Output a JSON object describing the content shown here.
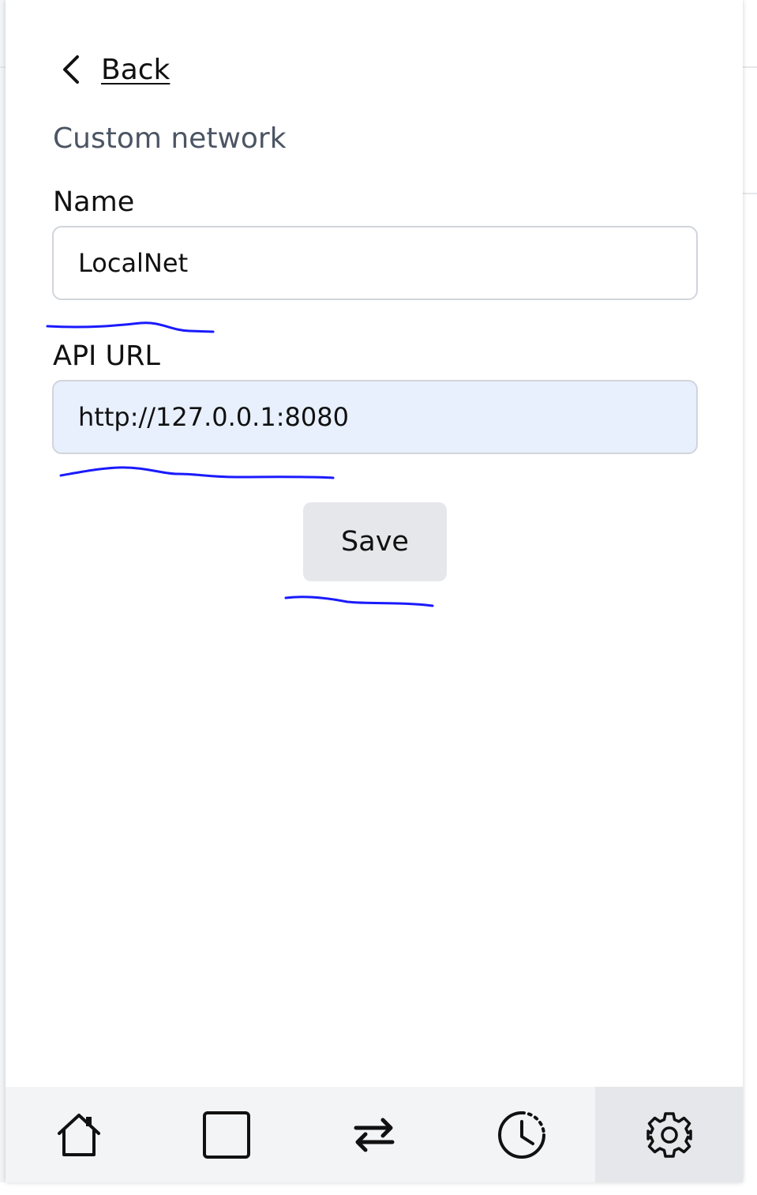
{
  "back": {
    "label": "Back"
  },
  "heading": "Custom network",
  "form": {
    "name_label": "Name",
    "name_value": "LocalNet",
    "api_url_label": "API URL",
    "api_url_value": "http://127.0.0.1:8080",
    "save_label": "Save"
  },
  "navbar": {
    "items": [
      {
        "icon": "home-icon",
        "active": false
      },
      {
        "icon": "square-icon",
        "active": false
      },
      {
        "icon": "transfer-icon",
        "active": false
      },
      {
        "icon": "history-clock-icon",
        "active": false
      },
      {
        "icon": "gear-icon",
        "active": true
      }
    ]
  },
  "colors": {
    "annotation": "#1a1aff",
    "url_field_bg": "#e8f0fe",
    "button_bg": "#e5e7eb",
    "navbar_bg": "#f3f4f6",
    "navbar_active_bg": "#e5e7eb"
  }
}
